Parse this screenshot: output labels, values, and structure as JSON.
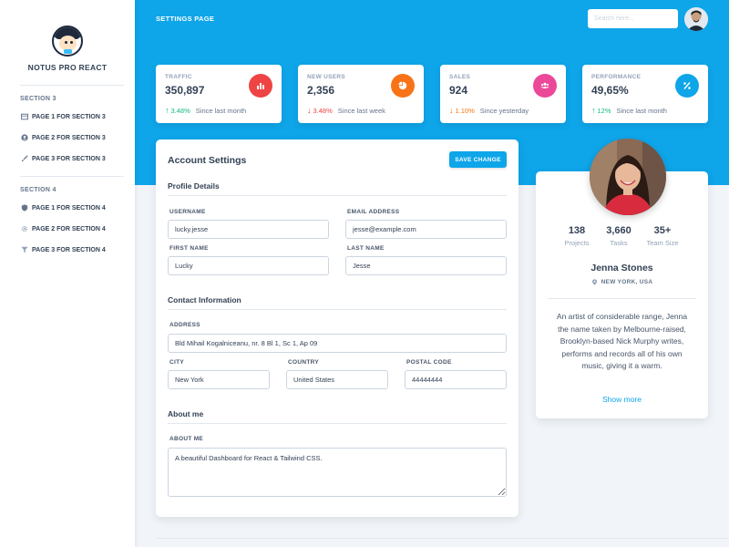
{
  "sidebar": {
    "brand": "NOTUS PRO REACT",
    "sections": [
      {
        "heading": "SECTION 3",
        "items": [
          {
            "label": "PAGE 1 FOR SECTION 3",
            "icon": "table-icon"
          },
          {
            "label": "PAGE 2 FOR SECTION 3",
            "icon": "user-circle-icon"
          },
          {
            "label": "PAGE 3 FOR SECTION 3",
            "icon": "paint-brush-icon"
          }
        ]
      },
      {
        "heading": "SECTION 4",
        "items": [
          {
            "label": "PAGE 1 FOR SECTION 4",
            "icon": "shield-icon"
          },
          {
            "label": "PAGE 2 FOR SECTION 4",
            "icon": "gear-icon"
          },
          {
            "label": "PAGE 3 FOR SECTION 4",
            "icon": "filter-icon"
          }
        ]
      }
    ]
  },
  "header": {
    "title": "SETTINGS PAGE",
    "search_placeholder": "Search here..."
  },
  "stats": [
    {
      "label": "TRAFFIC",
      "value": "350,897",
      "change": "3.48%",
      "direction": "up",
      "change_color": "#10b981",
      "period": "Since last month",
      "icon": "bar-chart-icon",
      "icon_color": "#ef4444"
    },
    {
      "label": "NEW USERS",
      "value": "2,356",
      "change": "3.48%",
      "direction": "down",
      "change_color": "#ef4444",
      "period": "Since last week",
      "icon": "pie-chart-icon",
      "icon_color": "#f97316"
    },
    {
      "label": "SALES",
      "value": "924",
      "change": "1.10%",
      "direction": "down",
      "change_color": "#f97316",
      "period": "Since yesterday",
      "icon": "users-icon",
      "icon_color": "#ec4899"
    },
    {
      "label": "PERFORMANCE",
      "value": "49,65%",
      "change": "12%",
      "direction": "up",
      "change_color": "#10b981",
      "period": "Since last month",
      "icon": "percent-icon",
      "icon_color": "#0ea5e9"
    }
  ],
  "account": {
    "title": "Account Settings",
    "save_label": "SAVE CHANGE",
    "profile_heading": "Profile Details",
    "contact_heading": "Contact Information",
    "about_heading": "About me",
    "fields": {
      "username": {
        "label": "USERNAME",
        "value": "lucky.jesse"
      },
      "email": {
        "label": "EMAIL ADDRESS",
        "value": "jesse@example.com"
      },
      "first_name": {
        "label": "FIRST NAME",
        "value": "Lucky"
      },
      "last_name": {
        "label": "LAST NAME",
        "value": "Jesse"
      },
      "address": {
        "label": "ADDRESS",
        "value": "Bld Mihail Kogalniceanu, nr. 8 Bl 1, Sc 1, Ap 09"
      },
      "city": {
        "label": "CITY",
        "value": "New York"
      },
      "country": {
        "label": "COUNTRY",
        "value": "United States"
      },
      "postal_code": {
        "label": "POSTAL CODE",
        "value": "44444444"
      },
      "about": {
        "label": "ABOUT ME",
        "value": "A beautiful Dashboard for React & Tailwind CSS."
      }
    }
  },
  "profile": {
    "stats": [
      {
        "value": "138",
        "label": "Projects"
      },
      {
        "value": "3,660",
        "label": "Tasks"
      },
      {
        "value": "35+",
        "label": "Team Size"
      }
    ],
    "name": "Jenna Stones",
    "location": "NEW YORK, USA",
    "bio": "An artist of considerable range, Jenna the name taken by Melbourne-raised, Brooklyn-based Nick Murphy writes, performs and records all of his own music, giving it a warm.",
    "show_more": "Show more"
  },
  "colors": {
    "accent": "#0ea5e9",
    "text_dark": "#334155"
  }
}
